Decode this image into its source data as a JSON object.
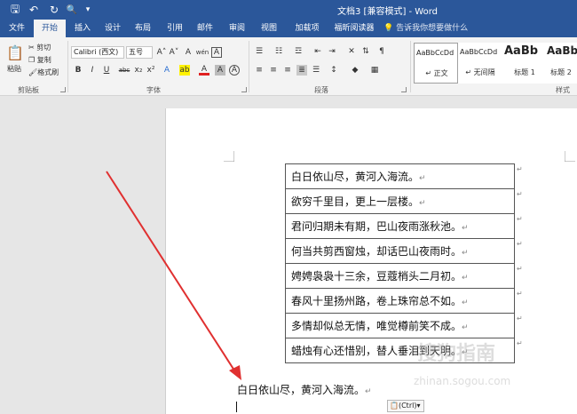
{
  "window": {
    "title": "文档3 [兼容模式] - Word"
  },
  "quick_access": {
    "save": "🖫",
    "undo": "↶",
    "redo": "↻",
    "print_preview": "🔍",
    "customize": "▾"
  },
  "tabs": [
    "文件",
    "开始",
    "插入",
    "设计",
    "布局",
    "引用",
    "邮件",
    "审阅",
    "视图",
    "加载项",
    "福昕阅读器"
  ],
  "active_tab": "开始",
  "tell_me": "告诉我你想要做什么",
  "ribbon": {
    "clipboard": {
      "paste": "粘贴",
      "cut": "剪切",
      "copy": "复制",
      "format_painter": "格式刷",
      "label": "剪贴板"
    },
    "font": {
      "name": "Calibri (西文)",
      "size": "五号",
      "grow": "A˄",
      "shrink": "A˅",
      "clear": "A",
      "phonetic": "wén",
      "border_char": "A",
      "bold": "B",
      "italic": "I",
      "underline": "U",
      "strike": "abc",
      "subscript": "x₂",
      "superscript": "x²",
      "effects": "A",
      "highlight": "ab",
      "color": "A",
      "shade": "A",
      "enclose": "A",
      "label": "字体"
    },
    "paragraph": {
      "label": "段落"
    },
    "styles": {
      "items": [
        {
          "sample": "AaBbCcDd",
          "name": "↵ 正文"
        },
        {
          "sample": "AaBbCcDd",
          "name": "↵ 无间隔"
        },
        {
          "sample": "AaBb",
          "name": "标题 1"
        },
        {
          "sample": "AaBb",
          "name": "标题 2"
        }
      ],
      "label": "样式"
    }
  },
  "document": {
    "table_rows": [
      "白日依山尽，黄河入海流。",
      "欲穷千里目，更上一层楼。",
      "君问归期未有期，巴山夜雨涨秋池。",
      "何当共剪西窗烛，却话巴山夜雨时。",
      "娉娉袅袅十三余，豆蔻梢头二月初。",
      "春风十里扬州路，卷上珠帘总不如。",
      "多情却似总无情，唯觉樽前笑不成。",
      "蜡烛有心还惜别，替人垂泪到天明。"
    ],
    "para_mark": "↵",
    "pasted_paragraph": "白日依山尽，黄河入海流。",
    "paste_options": "(Ctrl)▾"
  },
  "watermark": {
    "text": "搜狗指南",
    "url": "zhinan.sogou.com"
  },
  "colors": {
    "accent": "#2b579a",
    "arrow": "#e03030"
  }
}
